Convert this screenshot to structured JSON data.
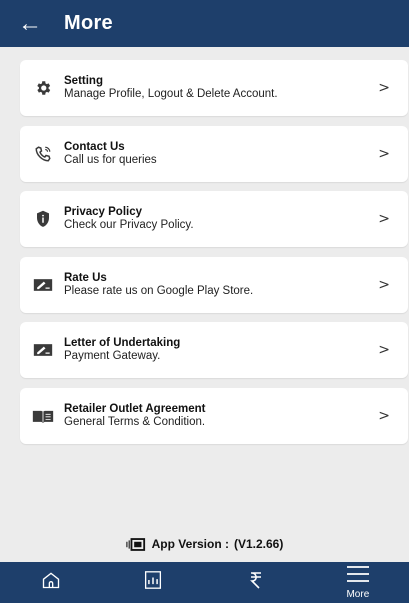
{
  "header": {
    "title": "More",
    "back_icon": "arrow-left-icon"
  },
  "menu": [
    {
      "title": "Setting",
      "subtitle": "Manage Profile, Logout & Delete Account.",
      "icon": "gear-icon"
    },
    {
      "title": "Contact Us",
      "subtitle": "Call us for queries",
      "icon": "phone-icon"
    },
    {
      "title": "Privacy Policy",
      "subtitle": "Check our Privacy Policy.",
      "icon": "shield-info-icon"
    },
    {
      "title": "Rate Us",
      "subtitle": "Please rate us on Google Play Store.",
      "icon": "rate-icon"
    },
    {
      "title": "Letter of Undertaking",
      "subtitle": "Payment Gateway.",
      "icon": "sign-icon"
    },
    {
      "title": "Retailer Outlet Agreement",
      "subtitle": "General Terms & Condition.",
      "icon": "book-icon"
    }
  ],
  "chevron": ">",
  "version": {
    "label": "App Version :",
    "value": "(V1.2.66)"
  },
  "bottom_nav": {
    "more_label": "More"
  },
  "colors": {
    "primary": "#1e3f6b",
    "background": "#ececec",
    "card": "#ffffff",
    "icon": "#3a3a3a"
  }
}
